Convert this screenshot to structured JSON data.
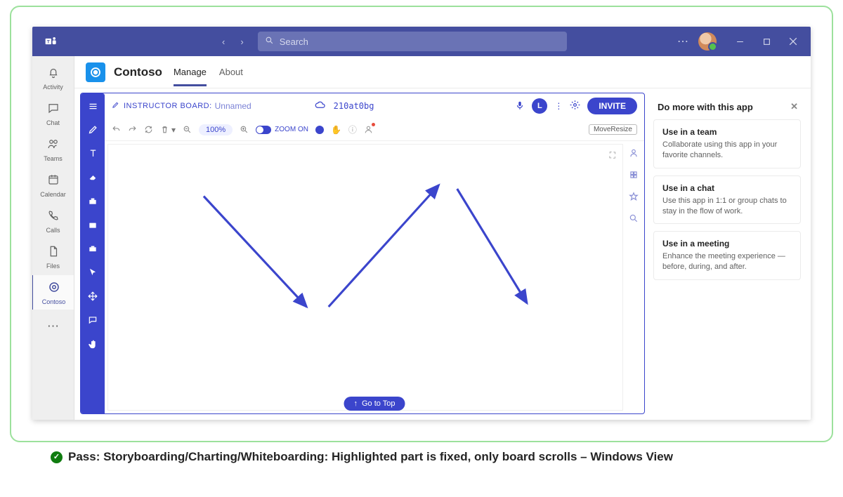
{
  "titlebar": {
    "search_placeholder": "Search"
  },
  "rail": {
    "items": [
      {
        "label": "Activity"
      },
      {
        "label": "Chat"
      },
      {
        "label": "Teams"
      },
      {
        "label": "Calendar"
      },
      {
        "label": "Calls"
      },
      {
        "label": "Files"
      },
      {
        "label": "Contoso"
      }
    ]
  },
  "app_header": {
    "app_name": "Contoso",
    "tabs": [
      {
        "label": "Manage"
      },
      {
        "label": "About"
      }
    ]
  },
  "board": {
    "title_label": "INSTRUCTOR BOARD:",
    "board_name": "Unnamed",
    "code": "210at0bg",
    "invite": "INVITE",
    "avatar_initial": "L",
    "zoom_percent": "100%",
    "zoom_on_label": "ZOOM ON",
    "move_resize": "MoveResize",
    "go_to_top": "Go to Top"
  },
  "side_panel": {
    "header": "Do more with this app",
    "cards": [
      {
        "title": "Use in a team",
        "desc": "Collaborate using this app in your favorite channels."
      },
      {
        "title": "Use in a chat",
        "desc": "Use this app in 1:1 or group chats to stay in the flow of work."
      },
      {
        "title": "Use in a meeting",
        "desc": "Enhance the meeting experience — before, during, and after."
      }
    ]
  },
  "caption": {
    "text": "Pass: Storyboarding/Charting/Whiteboarding: Highlighted part is fixed, only board scrolls – Windows View"
  }
}
